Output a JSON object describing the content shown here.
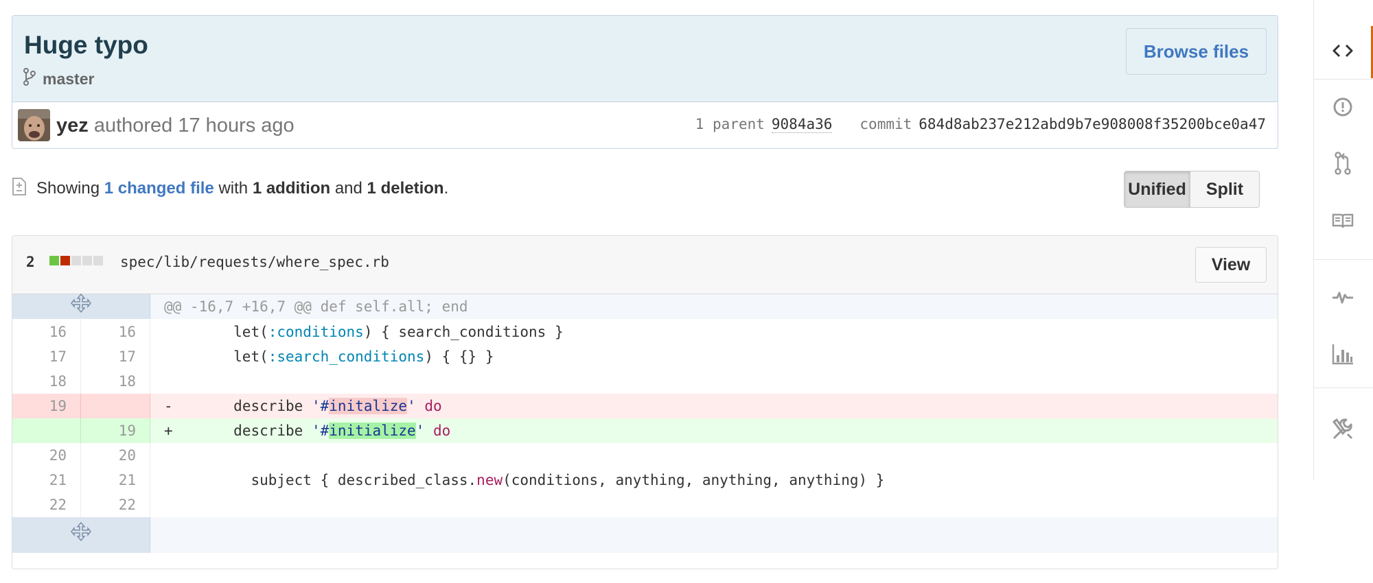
{
  "commit": {
    "title": "Huge typo",
    "branch": "master",
    "browse_label": "Browse files",
    "author": "yez",
    "authored_text": "authored 17 hours ago",
    "parent_label": "1 parent",
    "parent_sha": "9084a36",
    "commit_label": "commit",
    "commit_sha": "684d8ab237e212abd9b7e908008f35200bce0a47"
  },
  "toc": {
    "showing": "Showing",
    "changed_files": "1 changed file",
    "with": "with",
    "additions": "1 addition",
    "and": "and",
    "deletions": "1 deletion",
    "period": "."
  },
  "view_toggle": {
    "unified": "Unified",
    "split": "Split",
    "selected": "Unified"
  },
  "file": {
    "change_count": "2",
    "path": "spec/lib/requests/where_spec.rb",
    "view_label": "View",
    "diffstat": {
      "additions": 1,
      "deletions": 1,
      "neutral": 3
    }
  },
  "diff": {
    "hunk_header": "@@ -16,7 +16,7 @@ def self.all; end",
    "lines": [
      {
        "type": "context",
        "old": "16",
        "new": "16"
      },
      {
        "type": "context",
        "old": "17",
        "new": "17"
      },
      {
        "type": "context",
        "old": "18",
        "new": "18"
      },
      {
        "type": "deletion",
        "old": "19",
        "new": "",
        "marker": "-"
      },
      {
        "type": "addition",
        "old": "",
        "new": "19",
        "marker": "+"
      },
      {
        "type": "context",
        "old": "20",
        "new": "20"
      },
      {
        "type": "context",
        "old": "21",
        "new": "21"
      },
      {
        "type": "context",
        "old": "22",
        "new": "22"
      }
    ],
    "code": {
      "l1_a": "      let(",
      "l1_sym": ":conditions",
      "l1_b": ") { search_conditions }",
      "l2_a": "      let(",
      "l2_sym": ":search_conditions",
      "l2_b": ") { {} }",
      "del_a": "      describe ",
      "del_q1": "'#",
      "del_hl": "initalize",
      "del_q2": "'",
      "del_kw": "do",
      "add_a": "      describe ",
      "add_q1": "'#",
      "add_hl": "initialize",
      "add_q2": "'",
      "add_kw": "do",
      "l7_a": "        subject { described_class.",
      "l7_kw": "new",
      "l7_b": "(conditions, anything, anything, anything) }"
    }
  },
  "colors": {
    "accent": "#4078c0",
    "nav_selected": "#d26911",
    "addition": "#6cc644",
    "deletion": "#bd2c00"
  },
  "nav_icons": [
    "code-icon",
    "issue-icon",
    "pull-request-icon",
    "wiki-icon",
    "pulse-icon",
    "graph-icon",
    "settings-icon"
  ]
}
